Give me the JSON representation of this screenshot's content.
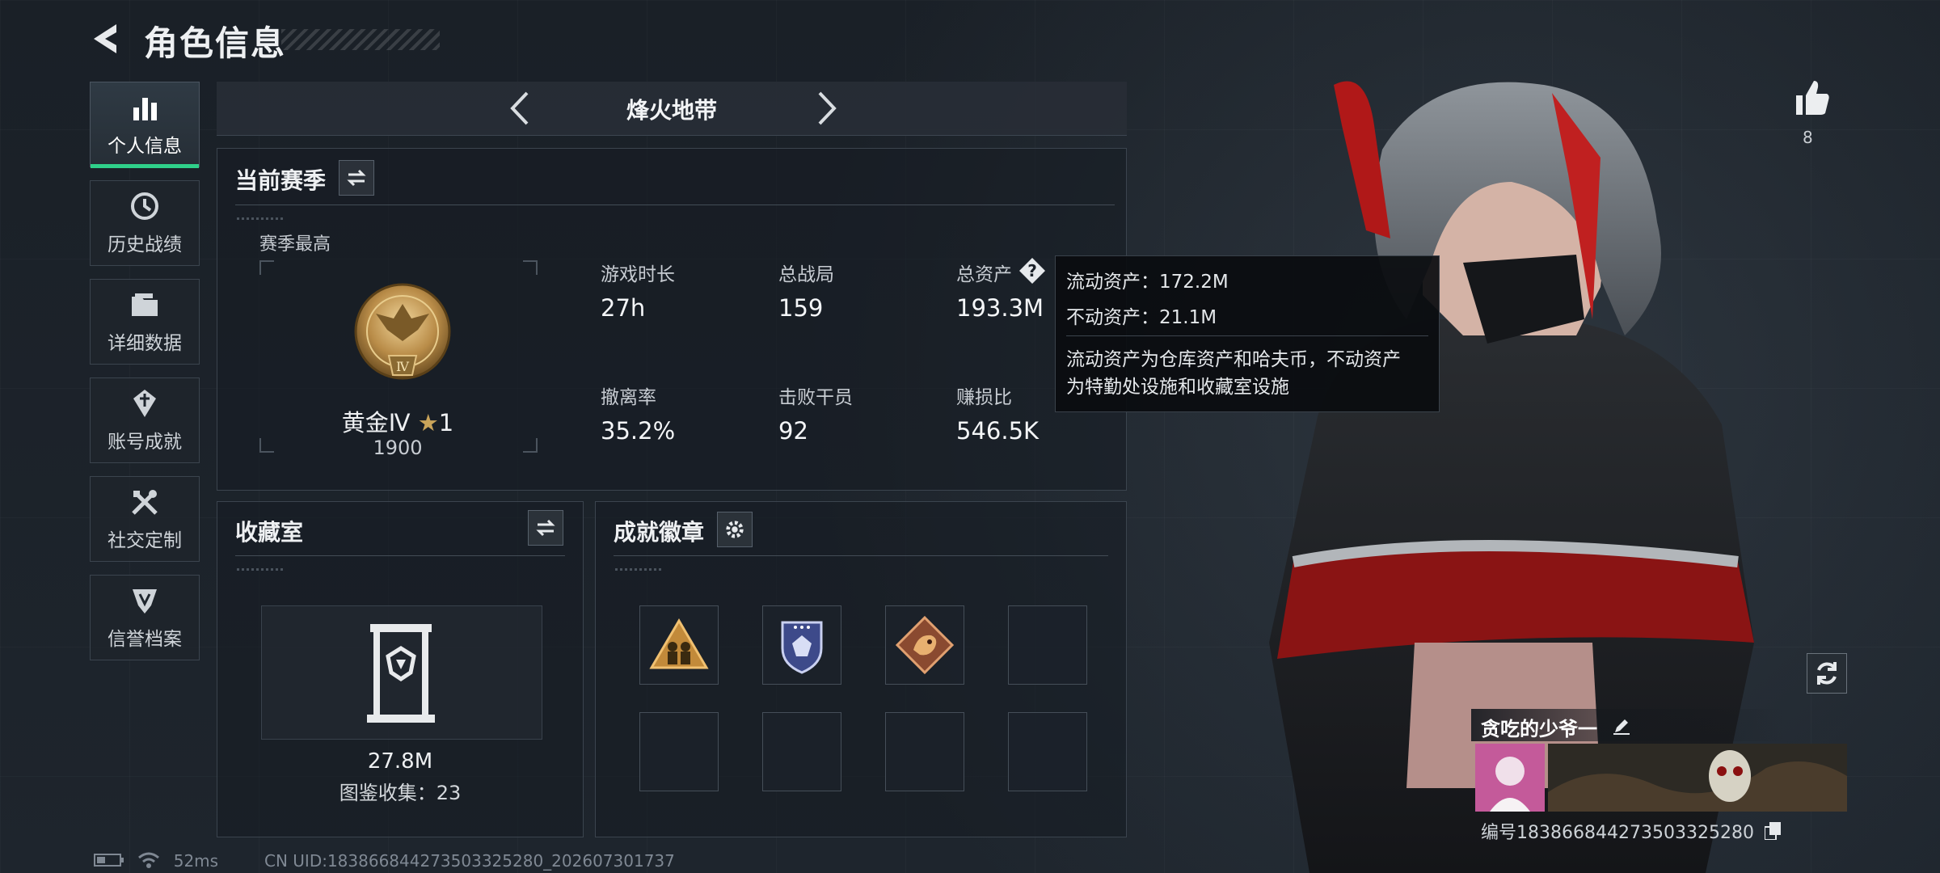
{
  "header": {
    "title": "角色信息"
  },
  "nav": {
    "items": [
      {
        "label": "个人信息",
        "icon": "bar-chart-icon",
        "active": true
      },
      {
        "label": "历史战绩",
        "icon": "clock-icon",
        "active": false
      },
      {
        "label": "详细数据",
        "icon": "folder-icon",
        "active": false
      },
      {
        "label": "账号成就",
        "icon": "achievement-icon",
        "active": false
      },
      {
        "label": "社交定制",
        "icon": "tools-icon",
        "active": false
      },
      {
        "label": "信誉档案",
        "icon": "shield-icon",
        "active": false
      }
    ]
  },
  "mode": {
    "label": "烽火地带"
  },
  "season": {
    "title": "当前赛季",
    "best_label": "赛季最高",
    "rank_name": "黄金Ⅳ",
    "rank_stars": "1",
    "rank_score": "1900",
    "rank_badge_numeral": "Ⅳ",
    "stats": [
      {
        "label": "游戏时长",
        "value": "27h"
      },
      {
        "label": "总战局",
        "value": "159"
      },
      {
        "label": "总资产",
        "value": "193.3M"
      },
      {
        "label": "撤离率",
        "value": "35.2%"
      },
      {
        "label": "击败干员",
        "value": "92"
      },
      {
        "label": "赚损比",
        "value": "546.5K"
      }
    ]
  },
  "tooltip": {
    "liquid": "流动资产：172.2M",
    "fixed": "不动资产：21.1M",
    "desc1": "流动资产为仓库资产和哈夫币，不动资产",
    "desc2": "为特勤处设施和收藏室设施"
  },
  "collection": {
    "title": "收藏室",
    "value": "27.8M",
    "catalog": "图鉴收集：23"
  },
  "badges": {
    "title": "成就徽章",
    "filled": [
      "triangle-soldiers-badge",
      "shield-gem-badge",
      "dragon-diamond-badge"
    ],
    "empty_slots": 5
  },
  "profile": {
    "likes": "8",
    "player_name": "贪吃的少爷一",
    "player_id": "编号1838668442735033252​80"
  },
  "status_bar": {
    "latency": "52ms",
    "uid": "CN UID:18386684427350332528​0_202607301737"
  },
  "colors": {
    "accent": "#2fd08a",
    "gold": "#c9a45a",
    "tooltip_bg": "#0a0c0f"
  }
}
